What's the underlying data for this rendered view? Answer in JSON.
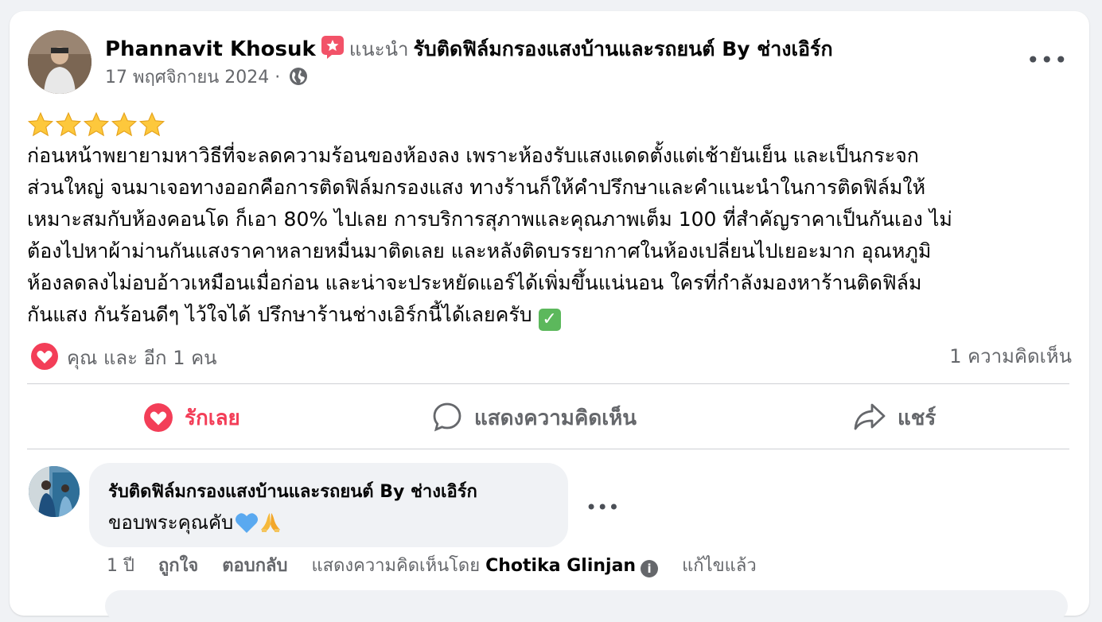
{
  "post": {
    "author": "Phannavit Khosuk",
    "recommend_label": "แนะนำ",
    "page_name": "รับติดฟิล์มกรองแสงบ้านและรถยนต์ By ช่างเอิร์ก",
    "date": "17 พฤศจิกายน 2024",
    "separator": "·",
    "privacy_icon": "globe-icon",
    "more_label": "•••",
    "rating": 5,
    "body": "ก่อนหน้าพยายามหาวิธีที่จะลดความร้อนของห้องลง เพราะห้องรับแสงแดดตั้งแต่เช้ายันเย็น และเป็นกระจก\nส่วนใหญ่ จนมาเจอทางออกคือการติดฟิล์มกรองแสง ทางร้านก็ให้คำปรึกษาและคำแนะนำในการติดฟิล์มให้\nเหมาะสมกับห้องคอนโด ก็เอา 80% ไปเลย การบริการสุภาพและคุณภาพเต็ม 100 ที่สำคัญราคาเป็นกันเอง ไม่\nต้องไปหาผ้าม่านกันแสงราคาหลายหมื่นมาติดเลย และหลังติดบรรยากาศในห้องเปลี่ยนไปเยอะมาก อุณหภูมิ\nห้องลดลงไม่อบอ้าวเหมือนเมื่อก่อน และน่าจะประหยัดแอร์ได้เพิ่มขึ้นแน่นอน ใครที่กำลังมองหาร้านติดฟิล์ม\nกันแสง กันร้อนดีๆ ไว้ใจได้ ปรึกษาร้านช่างเอิร์กนี้ได้เลยครับ",
    "check_emoji": "✓",
    "reactions_text": "คุณ และ อีก 1 คน",
    "comment_count": "1 ความคิดเห็น"
  },
  "actions": {
    "love": "รักเลย",
    "comment": "แสดงความคิดเห็น",
    "share": "แชร์"
  },
  "comment": {
    "author": "รับติดฟิล์มกรองแสงบ้านและรถยนต์ By ช่างเอิร์ก",
    "text": "ขอบพระคุณคับ",
    "more_label": "•••",
    "time": "1 ปี",
    "like": "ถูกใจ",
    "reply": "ตอบกลับ",
    "by_prefix": "แสดงความคิดเห็นโดย",
    "by_name": "Chotika Glinjan",
    "edited": "แก้ไขแล้ว"
  },
  "colors": {
    "love": "#f33e58",
    "muted": "#65676b",
    "bg": "#f0f2f5"
  }
}
